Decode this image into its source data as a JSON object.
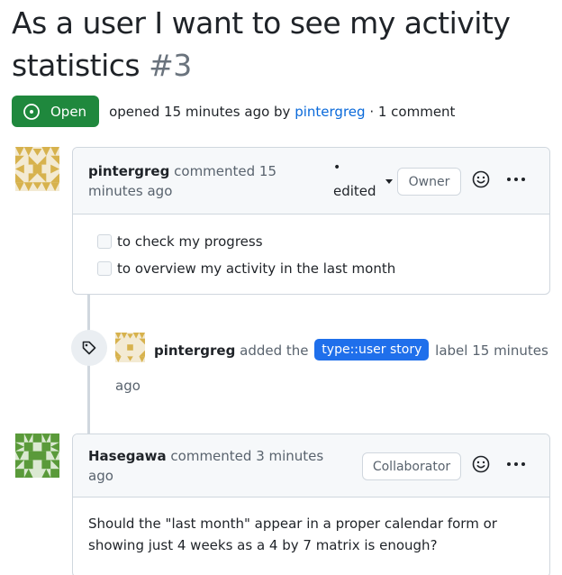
{
  "issue": {
    "title": "As a user I want to see my activity statistics",
    "number": "#3",
    "state": "Open",
    "meta_prefix": "opened 15 minutes ago by",
    "meta_author": "pintergreg",
    "meta_suffix": "· 1 comment"
  },
  "comments": [
    {
      "author": "pintergreg",
      "action": "commented 15 minutes ago",
      "edited_label": "edited",
      "edited_dot": "•",
      "role": "Owner",
      "tasks": [
        "to check my progress",
        "to overview my activity in the last month"
      ]
    },
    {
      "author": "Hasegawa",
      "action": "commented 3 minutes ago",
      "role": "Collaborator",
      "body": "Should the \"last month\" appear in a proper calendar form or showing just 4 weeks as a 4 by 7 matrix is enough?"
    }
  ],
  "event": {
    "author": "pintergreg",
    "action_prefix": "added the",
    "label": "type::user story",
    "action_suffix": "label 15 minutes ago",
    "icon": "tag-icon"
  },
  "colors": {
    "open_green": "#1f883d",
    "link_blue": "#0969da",
    "label_blue": "#1f6feb",
    "avatar_gold": "#d7b24d",
    "avatar_green": "#5a9a3a"
  }
}
